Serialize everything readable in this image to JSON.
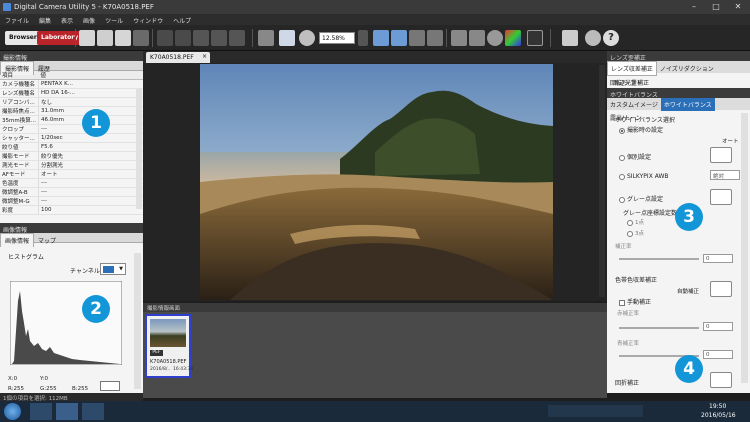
{
  "window": {
    "title": "Digital Camera Utility 5 - K70A0518.PEF"
  },
  "menu": [
    "ファイル",
    "編集",
    "表示",
    "画像",
    "ツール",
    "ウィンドウ",
    "ヘルプ"
  ],
  "toolbar": {
    "browser_label": "Browser",
    "laboratory_label": "Laboratory",
    "zoom_value": "12.58%"
  },
  "left_top": {
    "title": "撮影情報",
    "tabs": [
      "撮影情報",
      "履歴"
    ],
    "columns": [
      "項目",
      "値"
    ],
    "rows": [
      [
        "カメラ機種名",
        "PENTAX K..."
      ],
      [
        "レンズ機種名",
        "HD DA 16-..."
      ],
      [
        "リアコンバ...",
        "なし"
      ],
      [
        "撮影時焦点...",
        "31.0mm"
      ],
      [
        "35mm換算...",
        "46.0mm"
      ],
      [
        "クロップ",
        "---"
      ],
      [
        "シャッター...",
        "1/20sec"
      ],
      [
        "絞り値",
        "F5.6"
      ],
      [
        "撮影モード",
        "絞り優先"
      ],
      [
        "測光モード",
        "分割測光"
      ],
      [
        "AFモード",
        "オート"
      ],
      [
        "色温度",
        "---"
      ],
      [
        "微調整A-B",
        "---"
      ],
      [
        "微調整M-G",
        "---"
      ],
      [
        "彩度",
        "100"
      ]
    ]
  },
  "left_bottom": {
    "title": "画像情報",
    "tabs": [
      "画像情報",
      "マップ"
    ],
    "histogram_label": "ヒストグラム",
    "channel_label": "チャンネル",
    "readouts": [
      "X:0",
      "Y:0",
      "R:255",
      "G:255",
      "B:255"
    ]
  },
  "image_tab": {
    "name": "K70A0518.PEF",
    "close": "×"
  },
  "thumbs": {
    "header": "撮影情報画面",
    "items": [
      {
        "badge": "PEF",
        "name": "K70A0518.PEF",
        "date": "2016/8/..",
        "time": "16:43:38"
      }
    ]
  },
  "right": {
    "title": "レンズ歪補正",
    "top_tabs": [
      "レンズ収差補正",
      "ノイズリダクション",
      "回転/シフト"
    ],
    "lens_row": "周辺光量補正",
    "wb_header": "ホワイトバランス",
    "wb_tabs": [
      "カスタムイメージ",
      "ホワイトバランス",
      "露出/トーン"
    ],
    "wb_select_label": "ホワイトバランス選択",
    "options": [
      "撮影時の設定",
      "個別設定",
      "SILKYPIX AWB",
      "グレー点設定"
    ],
    "auto_label": "オート",
    "zettai_label": "絶対",
    "gray_range_label": "グレー点座標設定数",
    "gray_range_options": [
      "1点",
      "3点"
    ],
    "hosei_label": "補正率",
    "hosei_value": "0",
    "color_hosei_label": "色帯色収差補正",
    "auto_hosei_label": "自動補正",
    "manual_label": "手動補正",
    "red_label": "赤補正率",
    "red_value": "0",
    "blue_label": "青補正率",
    "blue_value": "0",
    "distortion_label": "回折補正"
  },
  "statusbar": {
    "text": "1個の項目を選択: 112MB"
  },
  "taskbar": {
    "time": "19:50",
    "date": "2016/05/16"
  },
  "badges": [
    "1",
    "2",
    "3",
    "4"
  ],
  "colors": {
    "badge": "#1296d8",
    "laboratory": "#b8242a",
    "accent_tab": "#2b6fb8"
  }
}
